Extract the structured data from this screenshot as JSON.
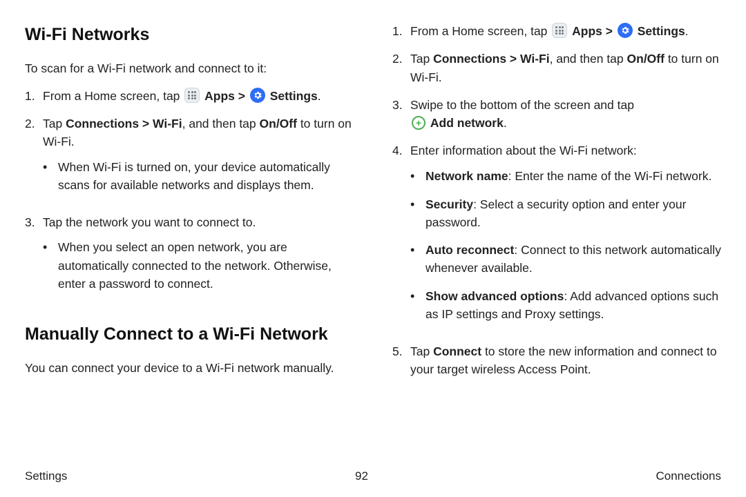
{
  "left": {
    "heading1": "Wi-Fi Networks",
    "intro": "To scan for a Wi-Fi network and connect to it:",
    "step1_pre": "From a Home screen, tap ",
    "apps_label": "Apps",
    "chevron": " > ",
    "settings_label": "Settings",
    "step2_a": "Tap ",
    "step2_b": "Connections > Wi-Fi",
    "step2_c": ", and then tap ",
    "step2_d": "On/Off",
    "step2_e": " to turn on Wi-Fi.",
    "step2_sub": "When Wi-Fi is turned on, your device automatically scans for available networks and displays them.",
    "step3": "Tap the network you want to connect to.",
    "step3_sub": "When you select an open network, you are automatically connected to the network. Otherwise, enter a password to connect.",
    "heading2": "Manually Connect to a Wi-Fi Network",
    "intro2": "You can connect your device to a Wi-Fi network manually."
  },
  "right": {
    "step1_pre": "From a Home screen, tap ",
    "apps_label": "Apps",
    "chevron": " > ",
    "settings_label": "Settings",
    "step2_a": "Tap ",
    "step2_b": "Connections > Wi-Fi",
    "step2_c": ", and then tap ",
    "step2_d": "On/Off",
    "step2_e": " to turn on Wi-Fi.",
    "step3_a": "Swipe to the bottom of the screen and tap ",
    "add_label": "Add network",
    "step4": "Enter information about the Wi-Fi network:",
    "b1_a": "Network name",
    "b1_b": ": Enter the name of the Wi-Fi network.",
    "b2_a": "Security",
    "b2_b": ": Select a security option and enter your password.",
    "b3_a": "Auto reconnect",
    "b3_b": ": Connect to this network automatically whenever available.",
    "b4_a": "Show advanced options",
    "b4_b": ": Add advanced options such as IP settings and Proxy settings.",
    "step5_a": "Tap ",
    "step5_b": "Connect",
    "step5_c": " to store the new information and connect to your target wireless Access Point."
  },
  "footer": {
    "left": "Settings",
    "center": "92",
    "right": "Connections"
  }
}
